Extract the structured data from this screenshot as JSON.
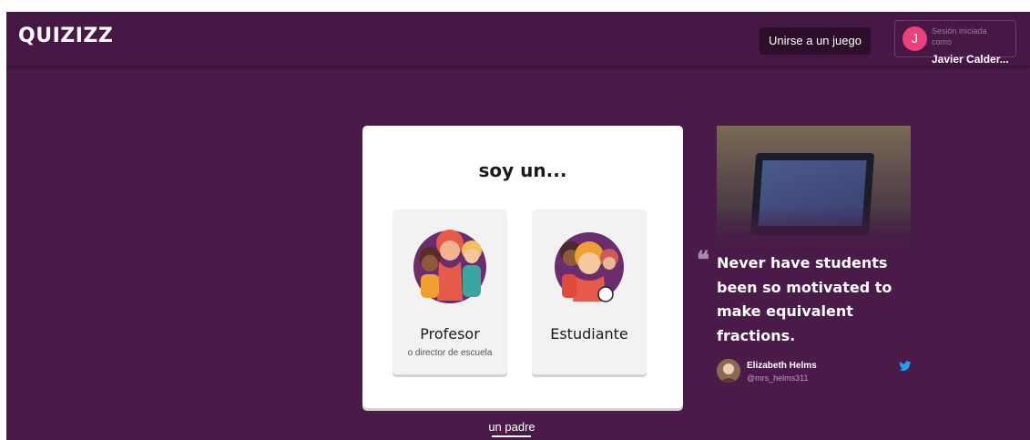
{
  "header": {
    "logo": "QUIZIZZ",
    "join_button": "Unirse a un juego",
    "session": {
      "avatar_initial": "J",
      "label": "Sesión iniciada como",
      "user": "Javier Calder..."
    }
  },
  "role_card": {
    "title": "soy un...",
    "options": [
      {
        "label": "Profesor",
        "sublabel": "o director de escuela",
        "icon": "teacher-illustration"
      },
      {
        "label": "Estudiante",
        "sublabel": "",
        "icon": "student-illustration"
      }
    ]
  },
  "parent_link": "un padre",
  "testimonial": {
    "quote": "Never have students been so motivated to make equivalent fractions.",
    "quote_mark": "❝",
    "author": "Elizabeth Helms",
    "handle": "@mrs_helms311",
    "social_icon": "twitter-icon"
  },
  "colors": {
    "background": "#4a1b48",
    "header": "#471846",
    "join_button": "#2c0f2b",
    "avatar": "#ec407a",
    "card": "#ffffff",
    "option": "#f2f2f2",
    "twitter": "#1da1f2"
  }
}
